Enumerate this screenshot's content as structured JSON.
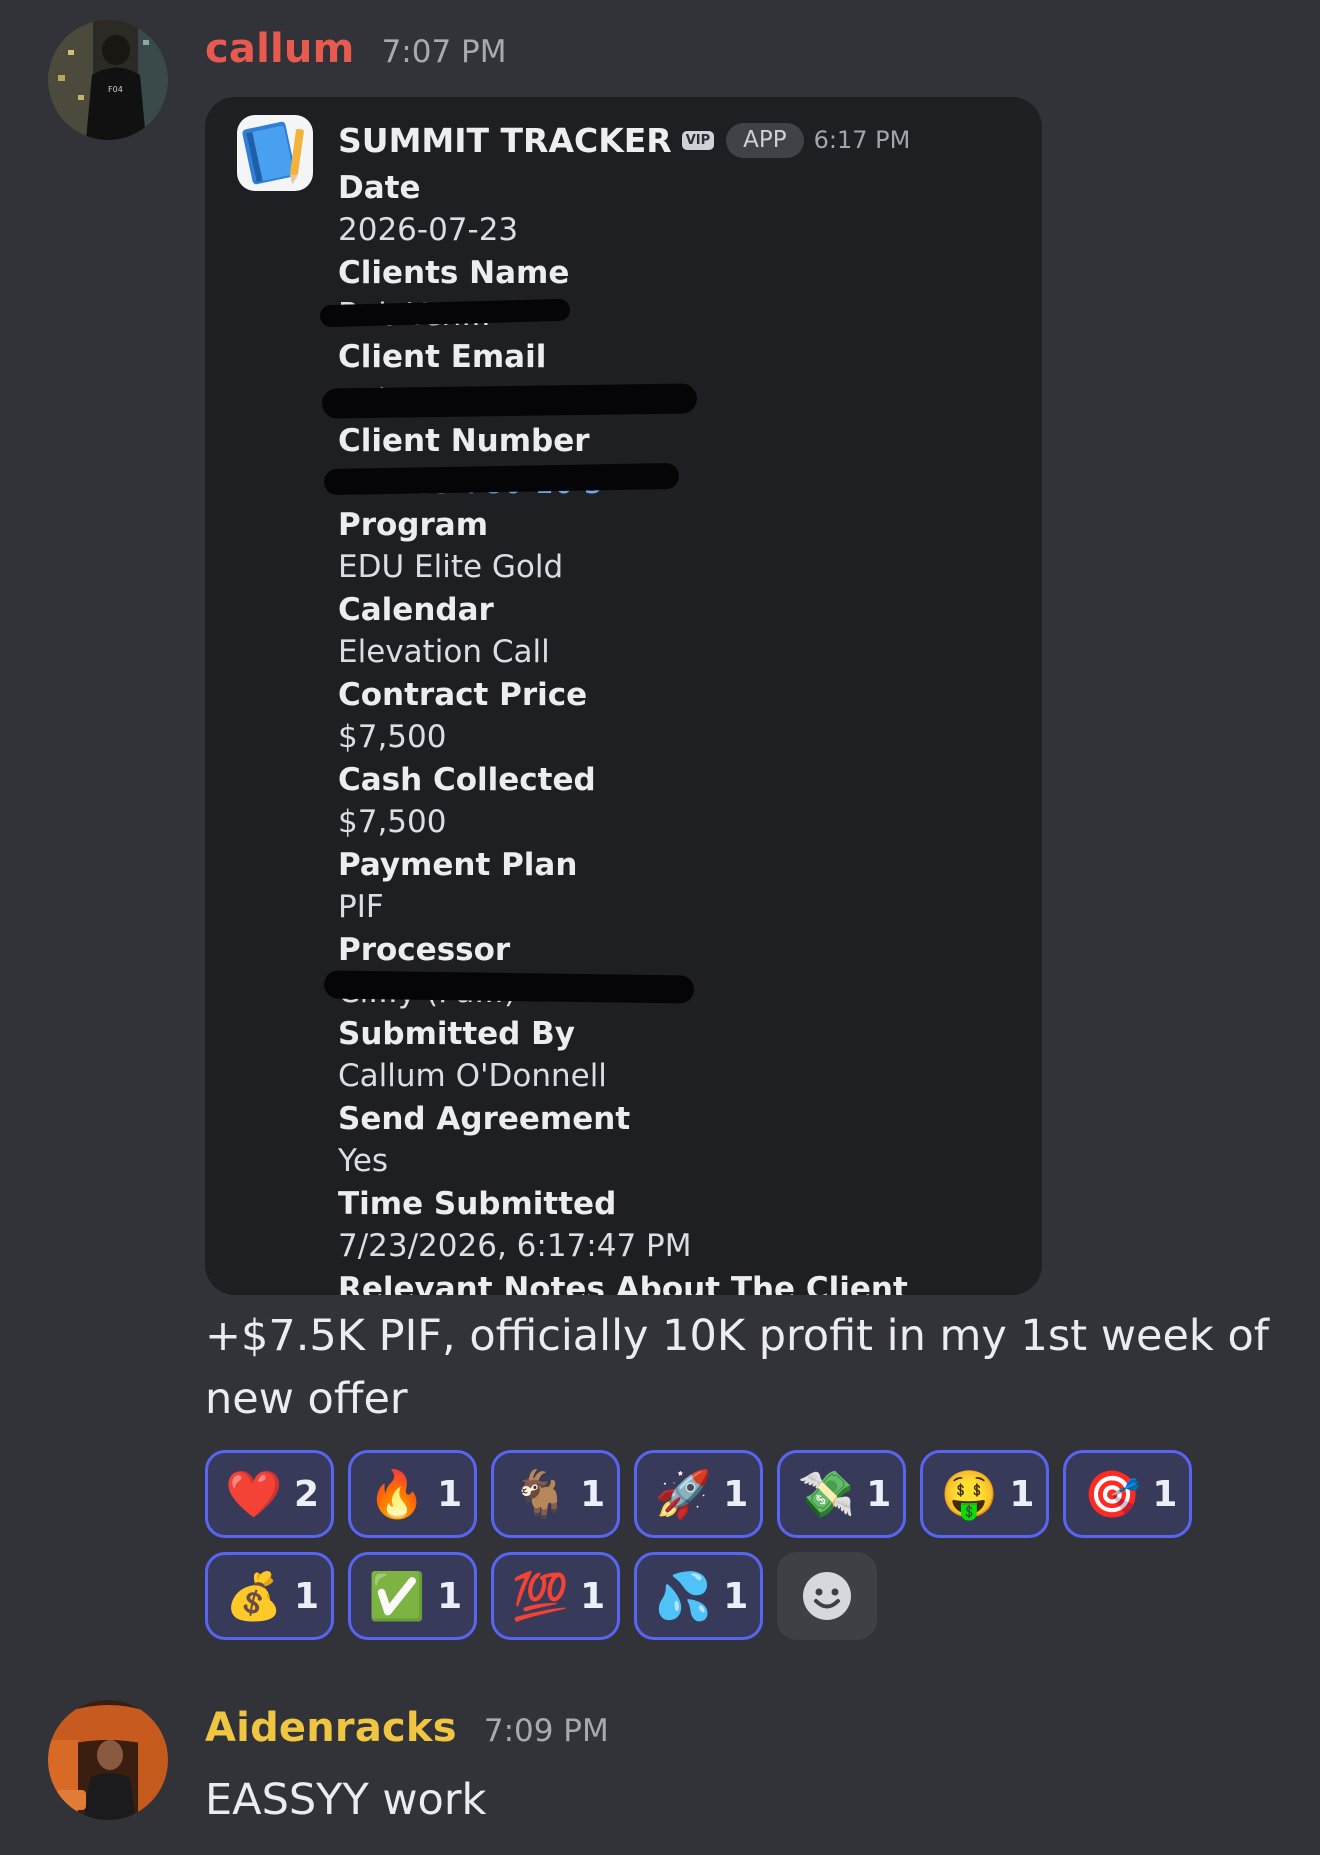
{
  "messages": [
    {
      "username": "callum",
      "username_color": "#e85a4f",
      "time": "7:07 PM",
      "text": "+$7.5K PIF, officially 10K profit in my 1st week of new offer"
    },
    {
      "username": "Aidenracks",
      "username_color": "#f0c542",
      "time": "7:09 PM",
      "text": "EASSYY work"
    }
  ],
  "embed": {
    "bot_name": "SUMMIT TRACKER",
    "vip_badge": "VIP",
    "app_badge": "APP",
    "time": "6:17 PM",
    "icon": "notebook-pencil-icon",
    "fields": [
      {
        "name": "Date",
        "value": "2026-07-23"
      },
      {
        "name": "Clients Name",
        "value": "Bob Yen...",
        "redacted": true
      },
      {
        "name": "Client Email",
        "value": "r...t",
        "redacted": true
      },
      {
        "name": "Client Number",
        "value": "+1 305-780-10 5",
        "redacted": true
      },
      {
        "name": "Program",
        "value": "EDU Elite Gold"
      },
      {
        "name": "Calendar",
        "value": "Elevation Call"
      },
      {
        "name": "Contract Price",
        "value": "$7,500"
      },
      {
        "name": "Cash Collected",
        "value": "$7,500"
      },
      {
        "name": "Payment Plan",
        "value": "PIF"
      },
      {
        "name": "Processor",
        "value": "Cl...y (Pa...)",
        "redacted": true
      },
      {
        "name": "Submitted By",
        "value": "Callum O'Donnell"
      },
      {
        "name": "Send Agreement",
        "value": "Yes"
      },
      {
        "name": "Time Submitted",
        "value": "7/23/2026, 6:17:47 PM"
      }
    ],
    "cut_off_field": "Relevant Notes About The Client"
  },
  "reactions": [
    [
      {
        "emoji": "❤️",
        "icon": "red-heart",
        "count": "2"
      },
      {
        "emoji": "🔥",
        "icon": "fire",
        "count": "1"
      },
      {
        "emoji": "🐐",
        "icon": "goat",
        "count": "1"
      },
      {
        "emoji": "🚀",
        "icon": "rocket",
        "count": "1"
      },
      {
        "emoji": "💸",
        "icon": "money-with-wings",
        "count": "1"
      },
      {
        "emoji": "🤑",
        "icon": "money-mouth-face",
        "count": "1"
      },
      {
        "emoji": "🎯",
        "icon": "direct-hit",
        "count": "1"
      }
    ],
    [
      {
        "emoji": "💰",
        "icon": "money-bag",
        "count": "1"
      },
      {
        "emoji": "✅",
        "icon": "check-mark-button",
        "count": "1"
      },
      {
        "emoji": "💯",
        "icon": "hundred-points",
        "count": "1"
      },
      {
        "emoji": "💦",
        "icon": "sweat-droplets",
        "count": "1"
      }
    ]
  ],
  "add_reaction_icon": "add-reaction-smiley-icon"
}
